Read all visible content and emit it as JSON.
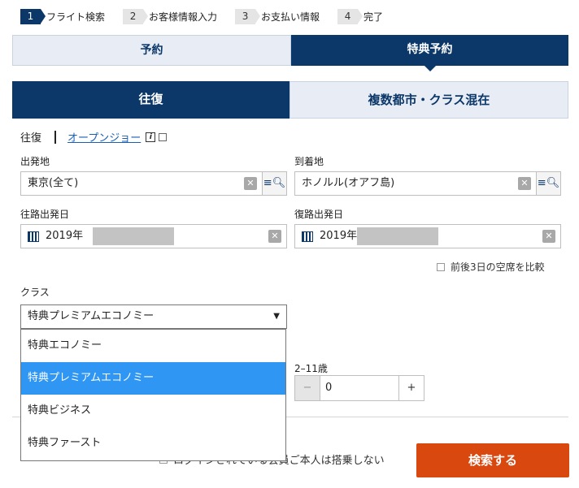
{
  "steps": [
    {
      "num": "1",
      "label": "フライト検索",
      "active": true
    },
    {
      "num": "2",
      "label": "お客様情報入力",
      "active": false
    },
    {
      "num": "3",
      "label": "お支払い情報",
      "active": false
    },
    {
      "num": "4",
      "label": "完了",
      "active": false
    }
  ],
  "booking_tabs": {
    "reserve": "予約",
    "award": "特典予約"
  },
  "trip_tabs": {
    "round_trip": "往復",
    "multi_city": "複数都市・クラス混在"
  },
  "subnav": {
    "round_trip": "往復",
    "open_jaw": "オープンジョー"
  },
  "origin": {
    "label": "出発地",
    "value": "東京(全て)"
  },
  "destination": {
    "label": "到着地",
    "value": "ホノルル(オアフ島)"
  },
  "outbound": {
    "label": "往路出発日",
    "value": "2019年"
  },
  "return": {
    "label": "復路出発日",
    "value": "2019年"
  },
  "compare_label": "前後3日の空席を比較",
  "class": {
    "label": "クラス",
    "selected": "特典プレミアムエコノミー",
    "options": [
      "特典エコノミー",
      "特典プレミアムエコノミー",
      "特典ビジネス",
      "特典ファースト"
    ],
    "selected_index": 1
  },
  "passengers": {
    "child_label": "2–11歳",
    "child_count": "0",
    "minus": "−",
    "plus": "+"
  },
  "bottom_note": "ログインされている会員ご本人は搭乗しない",
  "submit_label": "検索する",
  "colors": {
    "navy": "#0b3769",
    "accent": "#d9480f",
    "highlight": "#2f96f3"
  }
}
